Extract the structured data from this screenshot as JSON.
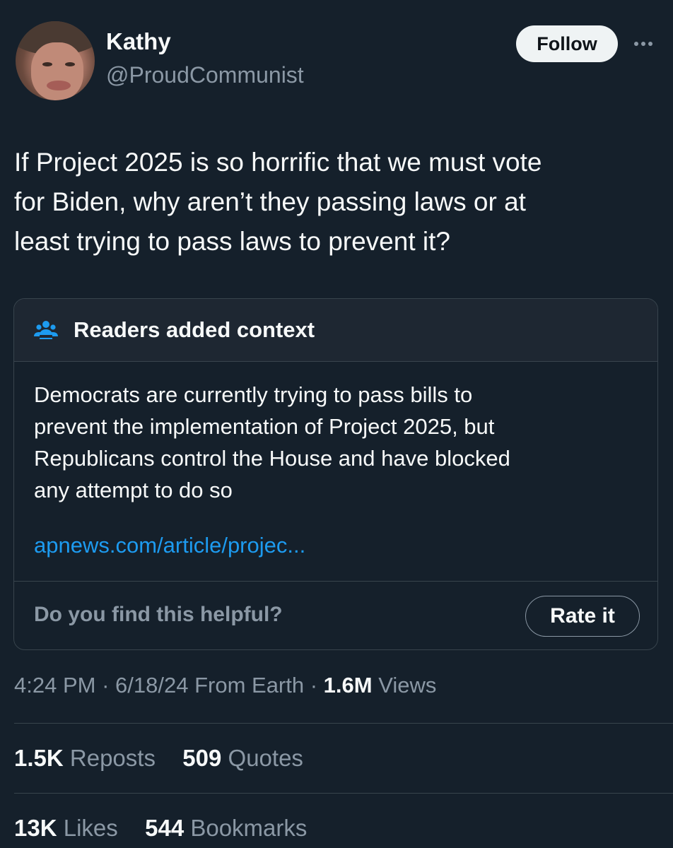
{
  "author": {
    "name": "Kathy",
    "handle": "@ProudCommunist"
  },
  "actions": {
    "follow_label": "Follow"
  },
  "tweet": {
    "text_lines": [
      "If Project 2025 is so horrific that we must vote",
      "for Biden, why aren’t they passing laws or at",
      "least trying to pass laws to prevent it?"
    ]
  },
  "community_note": {
    "title": "Readers added context",
    "body_lines": [
      "Democrats are currently trying to pass bills to",
      "prevent the implementation of Project 2025, but",
      "Republicans control the House and have blocked",
      "any attempt to do so"
    ],
    "link": "apnews.com/article/projec...",
    "helpful_question": "Do you find this helpful?",
    "rate_label": "Rate it"
  },
  "meta": {
    "time": "4:24 PM",
    "date": "6/18/24",
    "source": "From Earth",
    "views_count": "1.6M",
    "views_label": "Views"
  },
  "stats": {
    "reposts_count": "1.5K",
    "reposts_label": "Reposts",
    "quotes_count": "509",
    "quotes_label": "Quotes",
    "likes_count": "13K",
    "likes_label": "Likes",
    "bookmarks_count": "544",
    "bookmarks_label": "Bookmarks"
  },
  "colors": {
    "background": "#15202b",
    "text": "#f7f9f9",
    "muted": "#8b98a5",
    "link": "#1d9bf0",
    "note_header": "#1e2732",
    "border": "#38444d"
  }
}
